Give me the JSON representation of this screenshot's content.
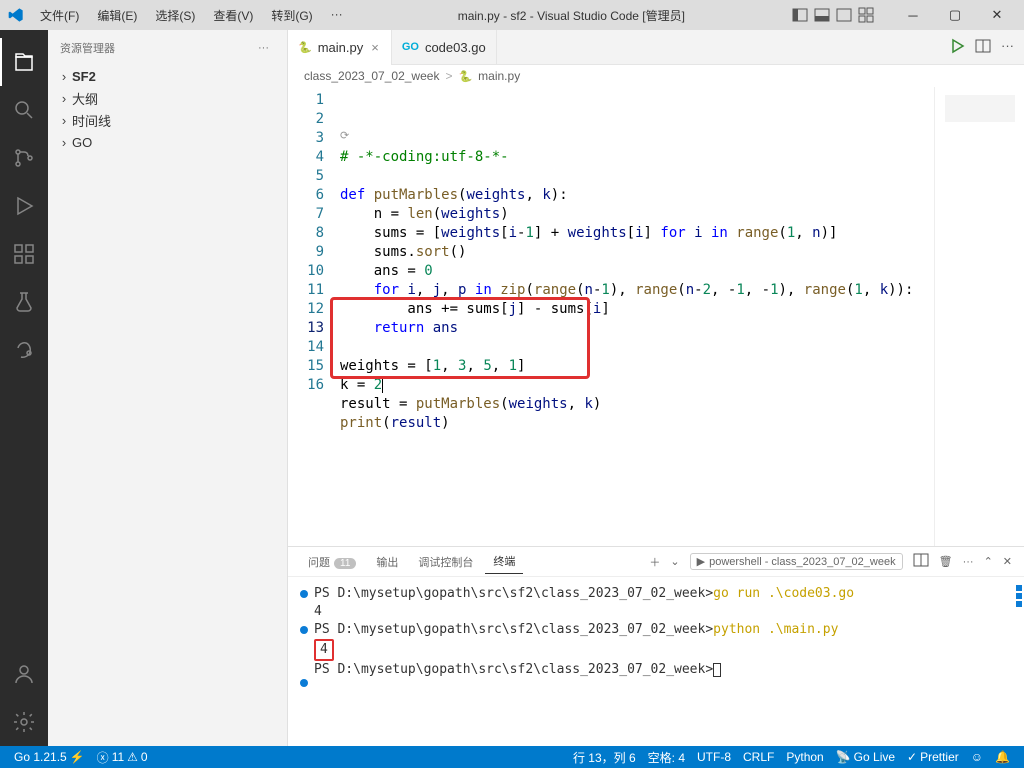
{
  "window": {
    "title": "main.py - sf2 - Visual Studio Code [管理员]"
  },
  "menu": {
    "file": "文件(F)",
    "edit": "编辑(E)",
    "select": "选择(S)",
    "view": "查看(V)",
    "goto": "转到(G)",
    "more": "···"
  },
  "sidebar": {
    "title": "资源管理器",
    "items": [
      {
        "label": "SF2"
      },
      {
        "label": "大纲"
      },
      {
        "label": "时间线"
      },
      {
        "label": "GO"
      }
    ]
  },
  "tabs": [
    {
      "icon": "py",
      "label": "main.py",
      "active": true,
      "close": "×"
    },
    {
      "icon": "go",
      "label": "code03.go",
      "active": false,
      "close": ""
    }
  ],
  "breadcrumb": {
    "folder": "class_2023_07_02_week",
    "sep": ">",
    "file": "main.py"
  },
  "code": {
    "lines": [
      {
        "n": 1,
        "seg": [
          {
            "t": "# -*-coding:utf-8-*-",
            "c": "cmt"
          }
        ]
      },
      {
        "n": 2,
        "seg": [
          {
            "t": "",
            "c": ""
          }
        ]
      },
      {
        "n": 3,
        "seg": [
          {
            "t": "def ",
            "c": "kw"
          },
          {
            "t": "putMarbles",
            "c": "fn"
          },
          {
            "t": "(",
            "c": "op"
          },
          {
            "t": "weights",
            "c": "var"
          },
          {
            "t": ", ",
            "c": "op"
          },
          {
            "t": "k",
            "c": "var"
          },
          {
            "t": "):",
            "c": "op"
          }
        ]
      },
      {
        "n": 4,
        "seg": [
          {
            "t": "    n = ",
            "c": "op"
          },
          {
            "t": "len",
            "c": "fn"
          },
          {
            "t": "(",
            "c": "op"
          },
          {
            "t": "weights",
            "c": "var"
          },
          {
            "t": ")",
            "c": "op"
          }
        ]
      },
      {
        "n": 5,
        "seg": [
          {
            "t": "    sums = [",
            "c": "op"
          },
          {
            "t": "weights",
            "c": "var"
          },
          {
            "t": "[",
            "c": "op"
          },
          {
            "t": "i",
            "c": "var"
          },
          {
            "t": "-",
            "c": "op"
          },
          {
            "t": "1",
            "c": "num"
          },
          {
            "t": "] + ",
            "c": "op"
          },
          {
            "t": "weights",
            "c": "var"
          },
          {
            "t": "[",
            "c": "op"
          },
          {
            "t": "i",
            "c": "var"
          },
          {
            "t": "] ",
            "c": "op"
          },
          {
            "t": "for ",
            "c": "kw"
          },
          {
            "t": "i",
            "c": "var"
          },
          {
            "t": " in ",
            "c": "kw"
          },
          {
            "t": "range",
            "c": "fn"
          },
          {
            "t": "(",
            "c": "op"
          },
          {
            "t": "1",
            "c": "num"
          },
          {
            "t": ", ",
            "c": "op"
          },
          {
            "t": "n",
            "c": "var"
          },
          {
            "t": ")]",
            "c": "op"
          }
        ]
      },
      {
        "n": 6,
        "seg": [
          {
            "t": "    sums.",
            "c": "op"
          },
          {
            "t": "sort",
            "c": "fn"
          },
          {
            "t": "()",
            "c": "op"
          }
        ]
      },
      {
        "n": 7,
        "seg": [
          {
            "t": "    ans = ",
            "c": "op"
          },
          {
            "t": "0",
            "c": "num"
          }
        ]
      },
      {
        "n": 8,
        "seg": [
          {
            "t": "    ",
            "c": "op"
          },
          {
            "t": "for ",
            "c": "kw"
          },
          {
            "t": "i",
            "c": "var"
          },
          {
            "t": ", ",
            "c": "op"
          },
          {
            "t": "j",
            "c": "var"
          },
          {
            "t": ", ",
            "c": "op"
          },
          {
            "t": "p",
            "c": "var"
          },
          {
            "t": " in ",
            "c": "kw"
          },
          {
            "t": "zip",
            "c": "fn"
          },
          {
            "t": "(",
            "c": "op"
          },
          {
            "t": "range",
            "c": "fn"
          },
          {
            "t": "(",
            "c": "op"
          },
          {
            "t": "n",
            "c": "var"
          },
          {
            "t": "-",
            "c": "op"
          },
          {
            "t": "1",
            "c": "num"
          },
          {
            "t": "), ",
            "c": "op"
          },
          {
            "t": "range",
            "c": "fn"
          },
          {
            "t": "(",
            "c": "op"
          },
          {
            "t": "n",
            "c": "var"
          },
          {
            "t": "-",
            "c": "op"
          },
          {
            "t": "2",
            "c": "num"
          },
          {
            "t": ", -",
            "c": "op"
          },
          {
            "t": "1",
            "c": "num"
          },
          {
            "t": ", -",
            "c": "op"
          },
          {
            "t": "1",
            "c": "num"
          },
          {
            "t": "), ",
            "c": "op"
          },
          {
            "t": "range",
            "c": "fn"
          },
          {
            "t": "(",
            "c": "op"
          },
          {
            "t": "1",
            "c": "num"
          },
          {
            "t": ", ",
            "c": "op"
          },
          {
            "t": "k",
            "c": "var"
          },
          {
            "t": ")):",
            "c": "op"
          }
        ]
      },
      {
        "n": 9,
        "seg": [
          {
            "t": "        ans += sums[",
            "c": "op"
          },
          {
            "t": "j",
            "c": "var"
          },
          {
            "t": "] - sums[",
            "c": "op"
          },
          {
            "t": "i",
            "c": "var"
          },
          {
            "t": "]",
            "c": "op"
          }
        ]
      },
      {
        "n": 10,
        "seg": [
          {
            "t": "    ",
            "c": "op"
          },
          {
            "t": "return ",
            "c": "kw"
          },
          {
            "t": "ans",
            "c": "var"
          }
        ]
      },
      {
        "n": 11,
        "seg": [
          {
            "t": "",
            "c": ""
          }
        ]
      },
      {
        "n": 12,
        "seg": [
          {
            "t": "weights = [",
            "c": "op"
          },
          {
            "t": "1",
            "c": "num"
          },
          {
            "t": ", ",
            "c": "op"
          },
          {
            "t": "3",
            "c": "num"
          },
          {
            "t": ", ",
            "c": "op"
          },
          {
            "t": "5",
            "c": "num"
          },
          {
            "t": ", ",
            "c": "op"
          },
          {
            "t": "1",
            "c": "num"
          },
          {
            "t": "]",
            "c": "op"
          }
        ]
      },
      {
        "n": 13,
        "seg": [
          {
            "t": "k = ",
            "c": "op"
          },
          {
            "t": "2",
            "c": "num"
          }
        ]
      },
      {
        "n": 14,
        "seg": [
          {
            "t": "result = ",
            "c": "op"
          },
          {
            "t": "putMarbles",
            "c": "fn"
          },
          {
            "t": "(",
            "c": "op"
          },
          {
            "t": "weights",
            "c": "var"
          },
          {
            "t": ", ",
            "c": "op"
          },
          {
            "t": "k",
            "c": "var"
          },
          {
            "t": ")",
            "c": "op"
          }
        ]
      },
      {
        "n": 15,
        "seg": [
          {
            "t": "print",
            "c": "fn"
          },
          {
            "t": "(",
            "c": "op"
          },
          {
            "t": "result",
            "c": "var"
          },
          {
            "t": ")",
            "c": "op"
          }
        ]
      },
      {
        "n": 16,
        "seg": [
          {
            "t": "",
            "c": ""
          }
        ]
      }
    ],
    "current_line": 13
  },
  "panel": {
    "tabs": {
      "problems": "问题",
      "problems_count": "11",
      "output": "输出",
      "debug": "调试控制台",
      "terminal": "终端"
    },
    "shell_label": "powershell - class_2023_07_02_week",
    "terminal_lines": [
      {
        "dot": true,
        "prompt": "PS D:\\mysetup\\gopath\\src\\sf2\\class_2023_07_02_week>",
        "cmd": " go run .\\code03.go"
      },
      {
        "out": "4"
      },
      {
        "dot": true,
        "prompt": "PS D:\\mysetup\\gopath\\src\\sf2\\class_2023_07_02_week>",
        "cmd": " python .\\main.py"
      },
      {
        "out": "4",
        "boxed": true
      },
      {
        "prompt": "PS D:\\mysetup\\gopath\\src\\sf2\\class_2023_07_02_week>",
        "cursor": true
      },
      {
        "dot": true
      }
    ]
  },
  "status": {
    "go": "Go 1.21.5",
    "go_icon": "⚡",
    "err_icon": "ⓧ",
    "err": "11",
    "warn_icon": "⚠",
    "warn": "0",
    "ln": "行 13，列 6",
    "spaces": "空格: 4",
    "enc": "UTF-8",
    "eol": "CRLF",
    "lang": "Python",
    "golive": "Go Live",
    "prettier": "Prettier",
    "feedback": "☺",
    "bell": "🔔"
  }
}
